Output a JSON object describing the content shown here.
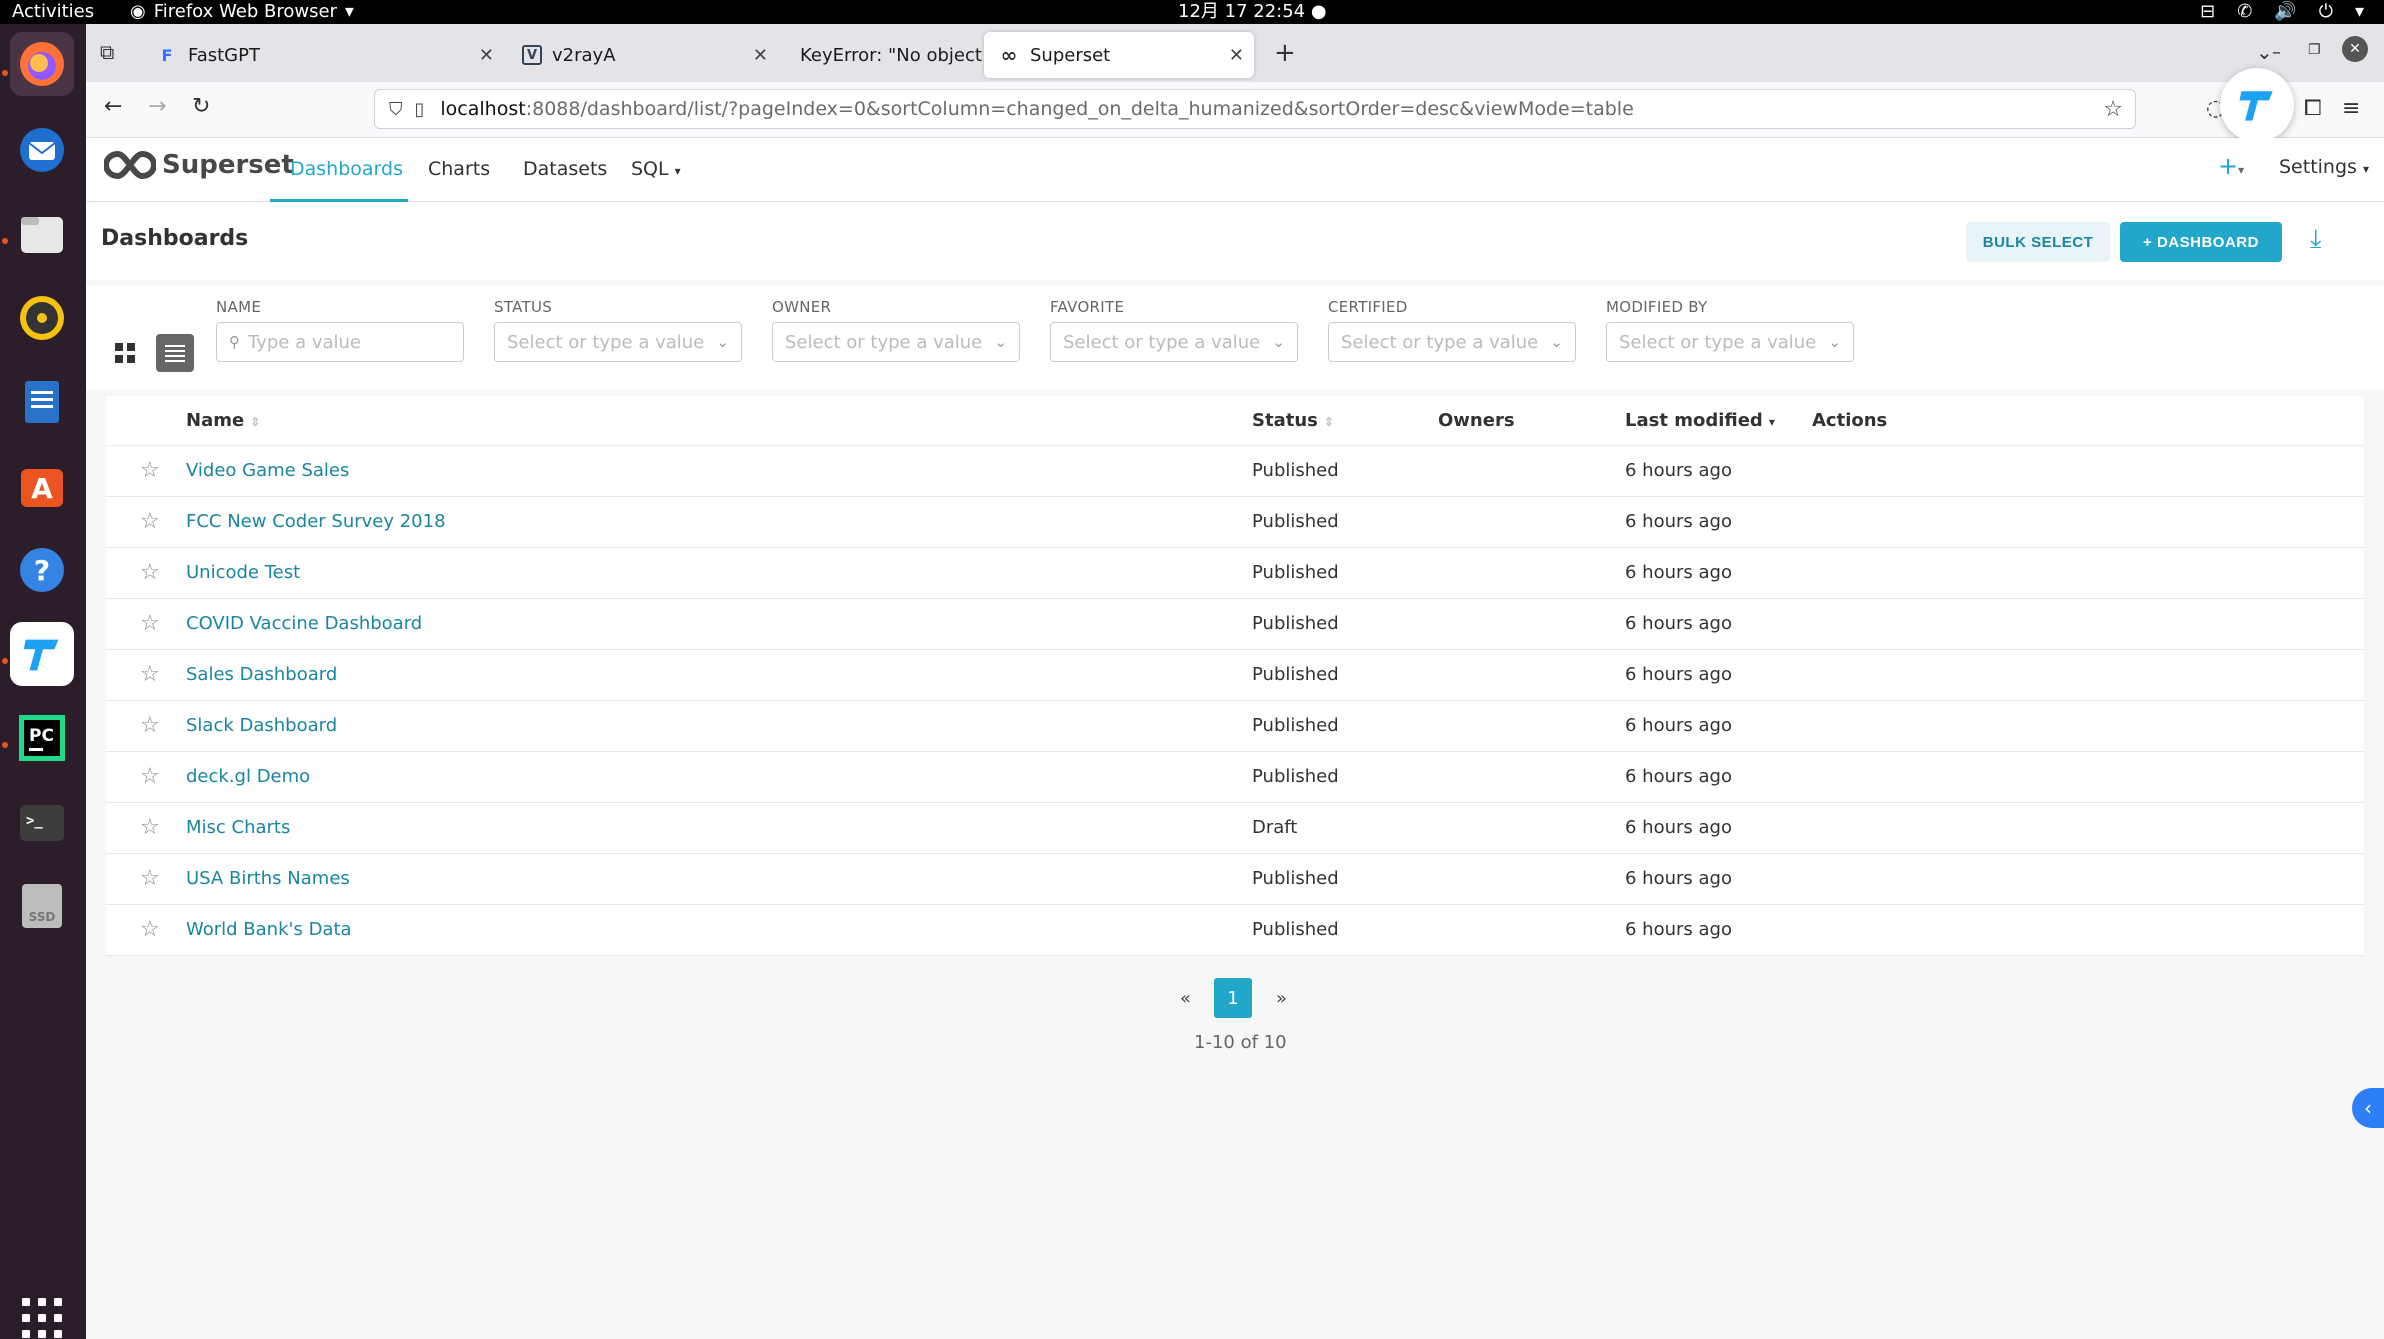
{
  "topbar": {
    "activities": "Activities",
    "app_name": "Firefox Web Browser",
    "clock": "12月 17  22:54"
  },
  "browser": {
    "tabs": [
      {
        "label": "FastGPT",
        "favicon": "F"
      },
      {
        "label": "v2rayA",
        "favicon": "V"
      },
      {
        "label": "KeyError: \"No object nam",
        "favicon": ""
      },
      {
        "label": "Superset",
        "favicon": "∞"
      }
    ],
    "url_host": "localhost",
    "url_rest": ":8088/dashboard/list/?pageIndex=0&sortColumn=changed_on_delta_humanized&sortOrder=desc&viewMode=table"
  },
  "app": {
    "logo": "Superset",
    "menu": {
      "dashboards": "Dashboards",
      "charts": "Charts",
      "datasets": "Datasets",
      "sql": "SQL"
    },
    "settings": "Settings",
    "page_title": "Dashboards",
    "bulk_select": "BULK SELECT",
    "add_dashboard": "DASHBOARD",
    "filters": {
      "name": {
        "label": "NAME",
        "placeholder": "Type a value"
      },
      "status": {
        "label": "STATUS",
        "placeholder": "Select or type a value"
      },
      "owner": {
        "label": "OWNER",
        "placeholder": "Select or type a value"
      },
      "favorite": {
        "label": "FAVORITE",
        "placeholder": "Select or type a value"
      },
      "certified": {
        "label": "CERTIFIED",
        "placeholder": "Select or type a value"
      },
      "modified_by": {
        "label": "MODIFIED BY",
        "placeholder": "Select or type a value"
      }
    },
    "table": {
      "headers": {
        "name": "Name",
        "status": "Status",
        "owners": "Owners",
        "last_modified": "Last modified",
        "actions": "Actions"
      },
      "rows": [
        {
          "name": "Video Game Sales",
          "status": "Published",
          "modified": "6 hours ago"
        },
        {
          "name": "FCC New Coder Survey 2018",
          "status": "Published",
          "modified": "6 hours ago"
        },
        {
          "name": "Unicode Test",
          "status": "Published",
          "modified": "6 hours ago"
        },
        {
          "name": "COVID Vaccine Dashboard",
          "status": "Published",
          "modified": "6 hours ago"
        },
        {
          "name": "Sales Dashboard",
          "status": "Published",
          "modified": "6 hours ago"
        },
        {
          "name": "Slack Dashboard",
          "status": "Published",
          "modified": "6 hours ago"
        },
        {
          "name": "deck.gl Demo",
          "status": "Published",
          "modified": "6 hours ago"
        },
        {
          "name": "Misc Charts",
          "status": "Draft",
          "modified": "6 hours ago"
        },
        {
          "name": "USA Births Names",
          "status": "Published",
          "modified": "6 hours ago"
        },
        {
          "name": "World Bank's Data",
          "status": "Published",
          "modified": "6 hours ago"
        }
      ]
    },
    "pagination": {
      "prev": "«",
      "current": "1",
      "next": "»",
      "summary": "1-10 of 10"
    }
  },
  "colors": {
    "accent": "#20a7c9",
    "link": "#1a85a0"
  }
}
